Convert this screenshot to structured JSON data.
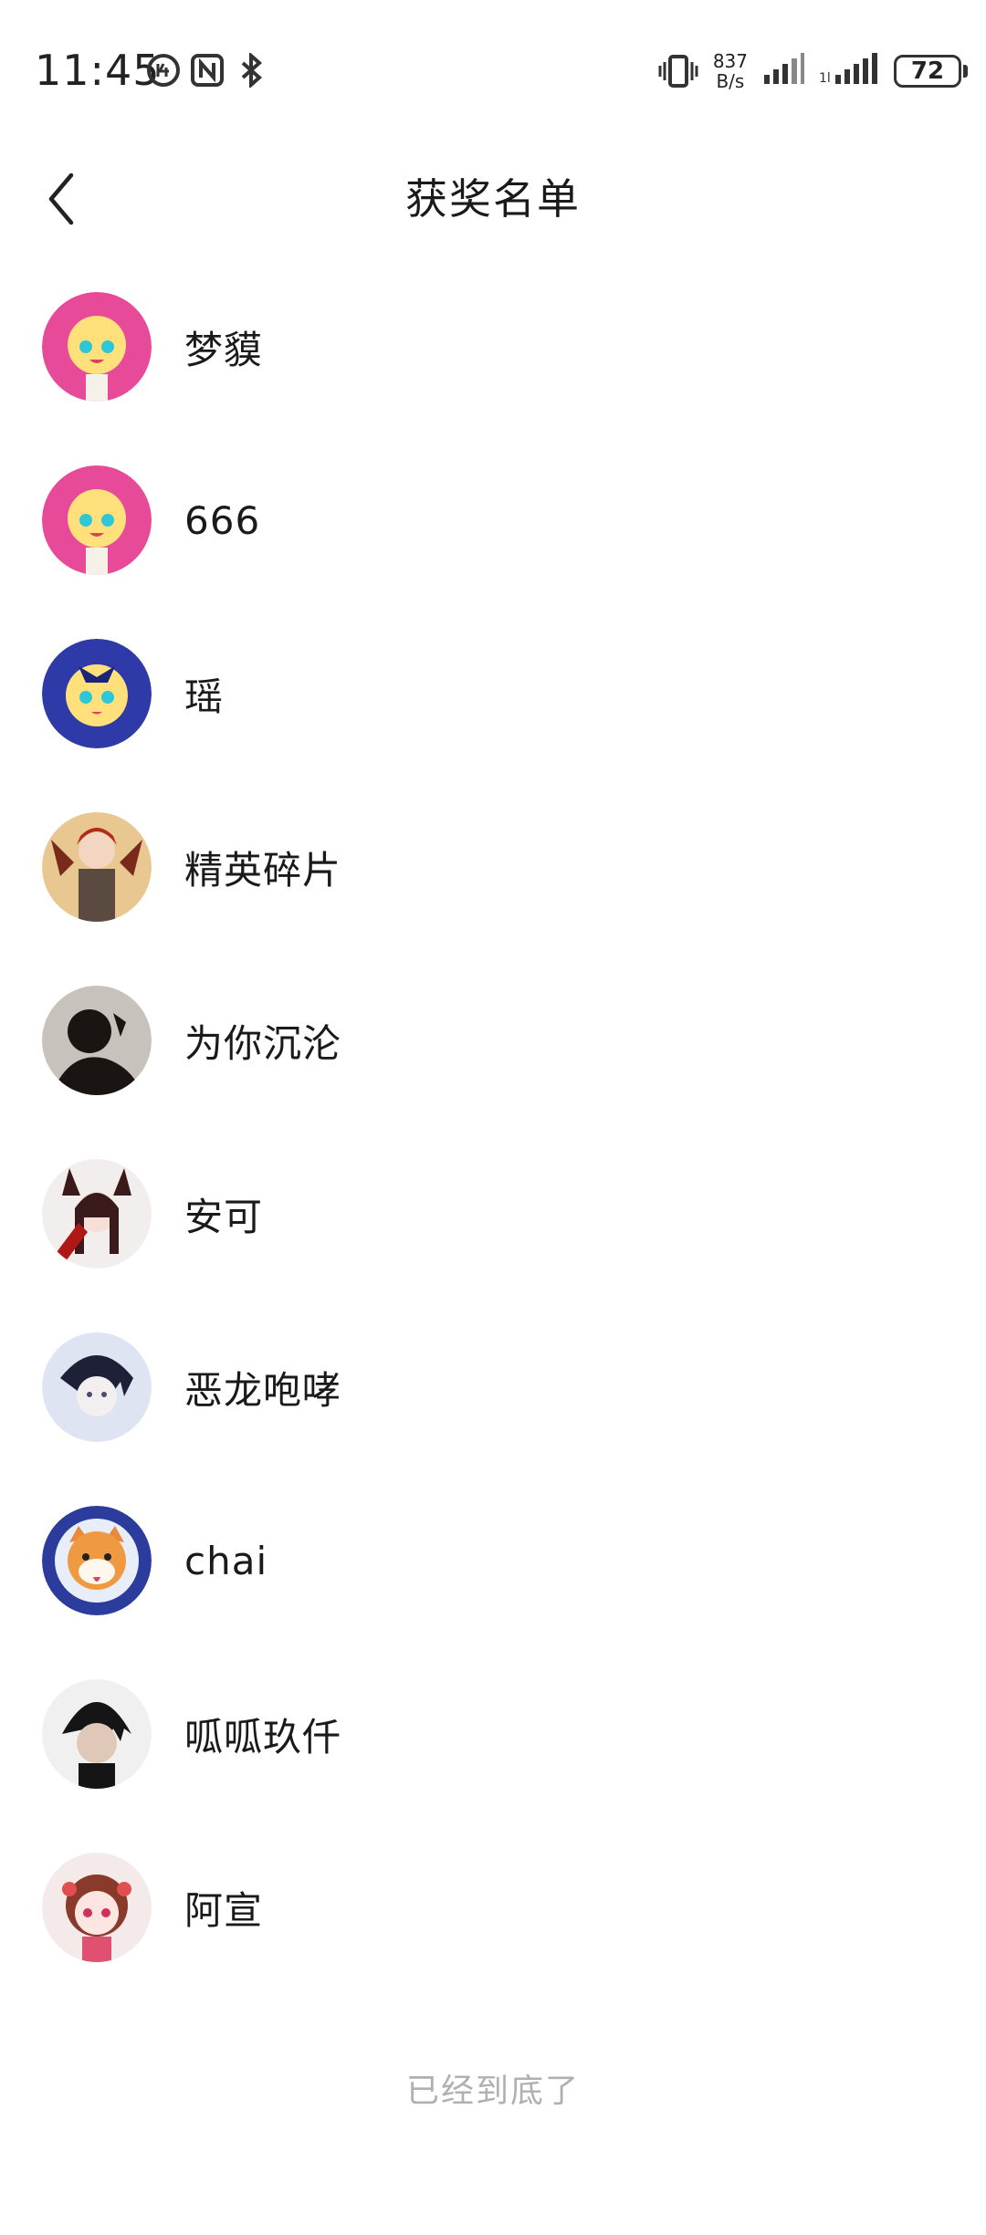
{
  "status_bar": {
    "time": "11:45",
    "net_speed_value": "837",
    "net_speed_unit": "B/s",
    "battery": "72",
    "icons": [
      "notification-badge-icon",
      "nfc-icon",
      "bluetooth-icon",
      "vibrate-icon",
      "signal-icon",
      "signal-icon"
    ]
  },
  "header": {
    "title": "获奖名单",
    "back_icon": "chevron-left-icon"
  },
  "winners": [
    {
      "name": "梦貘"
    },
    {
      "name": "666"
    },
    {
      "name": "瑶"
    },
    {
      "name": "精英碎片"
    },
    {
      "name": "为你沉沦"
    },
    {
      "name": "安可"
    },
    {
      "name": "恶龙咆哮"
    },
    {
      "name": "chai"
    },
    {
      "name": "呱呱玖仟"
    },
    {
      "name": "阿宣"
    }
  ],
  "footer": {
    "text": "已经到底了"
  },
  "colors": {
    "background": "#ffffff",
    "text": "#1a1a1a",
    "muted": "#b0b0b0"
  }
}
